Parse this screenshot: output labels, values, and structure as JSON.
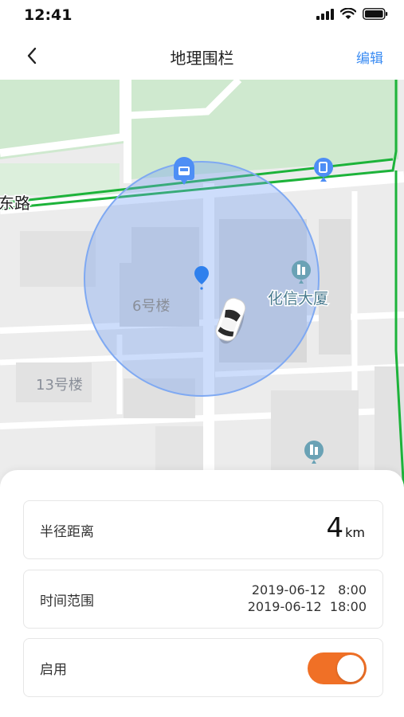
{
  "status_bar": {
    "time": "12:41",
    "icons": [
      "signal-icon",
      "wifi-icon",
      "battery-icon"
    ]
  },
  "nav": {
    "back_icon": "chevron-left-icon",
    "title": "地理围栏",
    "edit_label": "编辑"
  },
  "map": {
    "labels": {
      "road": "东路",
      "building_6": "6号楼",
      "building_13": "13号楼",
      "poi_huaxin": "化信大厦"
    },
    "fence_color": "#7fa9f2",
    "boundary_color": "#1db33a",
    "icons": [
      "bus-stop-icon",
      "exit-icon",
      "location-pin-icon",
      "building-poi-icon",
      "building-poi-icon",
      "car-icon"
    ]
  },
  "settings": {
    "radius": {
      "label": "半径距离",
      "value": "4",
      "unit": "km"
    },
    "time_range": {
      "label": "时间范围",
      "start": "2019-06-12   8:00",
      "end": "2019-06-12  18:00"
    },
    "enable": {
      "label": "启用",
      "on": true,
      "accent": "#f07026"
    }
  }
}
